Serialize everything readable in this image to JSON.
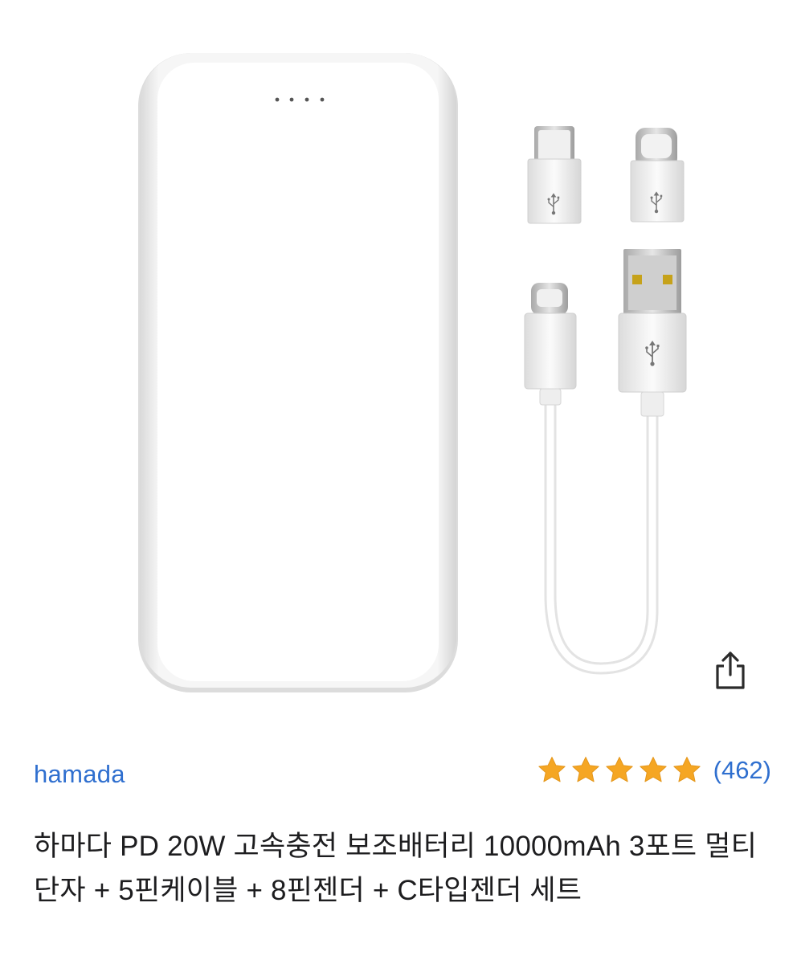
{
  "product": {
    "brand": "hamada",
    "review_count": "(462)",
    "rating_stars": 5,
    "rating_max": 5,
    "title": "하마다 PD 20W 고속충전 보조배터리 10000mAh 3포트 멀티단자 + 5핀케이블 + 8핀젠더 + C타입젠더 세트"
  },
  "icons": {
    "share": "share-icon",
    "star": "star-icon"
  },
  "colors": {
    "link": "#2f6fcf",
    "star": "#f5a623",
    "text": "#1d1d1f",
    "background": "#ffffff"
  }
}
